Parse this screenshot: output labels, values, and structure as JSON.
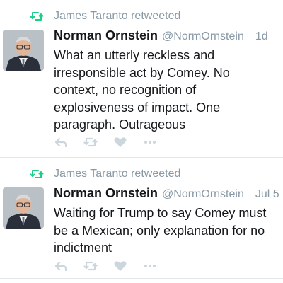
{
  "tweets": [
    {
      "retweeted_by": "James Taranto retweeted",
      "author_name": "Norman Ornstein",
      "handle": "@NormOrnstein",
      "time": "1d",
      "text": "What an utterly reckless and irresponsible act by Comey. No context, no recognition of explosiveness of impact. One paragraph. Outrageous"
    },
    {
      "retweeted_by": "James Taranto retweeted",
      "author_name": "Norman Ornstein",
      "handle": "@NormOrnstein",
      "time": "Jul 5",
      "text": "Waiting for Trump to say Comey must be a Mexican; only explanation for no indictment"
    }
  ],
  "icons": {
    "retweet_context": "retweet-icon",
    "reply": "reply-icon",
    "retweet": "retweet-icon",
    "like": "heart-icon",
    "more": "more-icon"
  },
  "colors": {
    "retweet_green": "#19cf86",
    "muted_gray": "#8899a6",
    "action_gray": "#ccd6dd",
    "text": "#14171a",
    "divider": "#e1e8ed"
  }
}
